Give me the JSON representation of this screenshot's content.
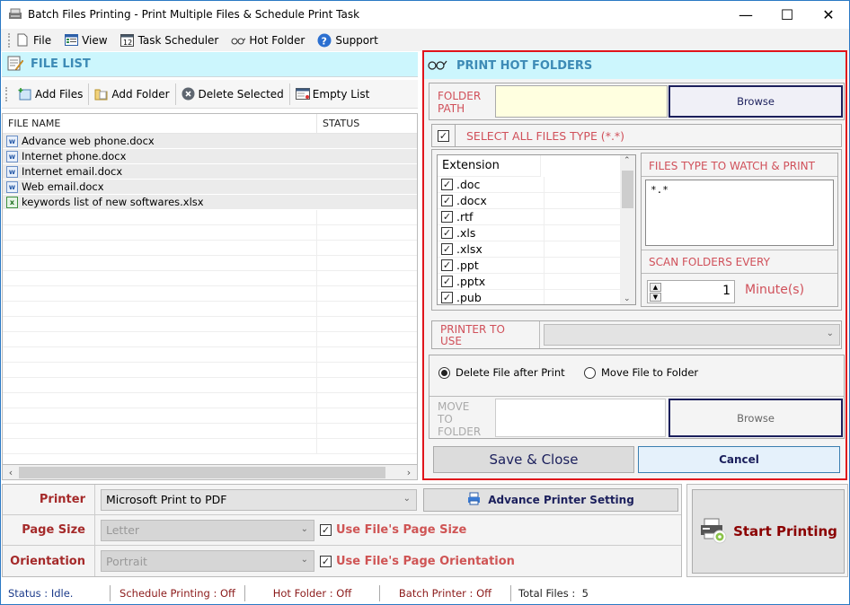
{
  "window": {
    "title": "Batch Files Printing - Print Multiple Files & Schedule Print Task",
    "minimize_glyph": "—",
    "maximize_glyph": "☐",
    "close_glyph": "✕"
  },
  "menu": [
    {
      "label": "File",
      "icon": "file-icon"
    },
    {
      "label": "View",
      "icon": "view-icon"
    },
    {
      "label": "Task Scheduler",
      "icon": "calendar-icon"
    },
    {
      "label": "Hot Folder",
      "icon": "glasses-icon"
    },
    {
      "label": "Support",
      "icon": "help-icon"
    }
  ],
  "file_list": {
    "title": "FILE LIST",
    "toolbar": {
      "add_files": "Add Files",
      "add_folder": "Add Folder",
      "delete_selected": "Delete Selected",
      "empty_list": "Empty List"
    },
    "columns": [
      "FILE NAME",
      "STATUS"
    ],
    "files": [
      {
        "name": "Advance web phone.docx",
        "type": "word",
        "status": ""
      },
      {
        "name": "Internet phone.docx",
        "type": "word",
        "status": ""
      },
      {
        "name": "Internet email.docx",
        "type": "word",
        "status": ""
      },
      {
        "name": "Web email.docx",
        "type": "word",
        "status": ""
      },
      {
        "name": "keywords list of new softwares.xlsx",
        "type": "excel",
        "status": ""
      }
    ]
  },
  "hot_folder": {
    "title": "PRINT HOT FOLDERS",
    "folder_path_label_1": "FOLDER",
    "folder_path_label_2": "PATH",
    "folder_path_value": "",
    "browse": "Browse",
    "select_all_label": "SELECT ALL FILES TYPE (*.*)",
    "select_all_checked": true,
    "extension_header": "Extension",
    "extensions": [
      {
        "ext": ".doc",
        "checked": true
      },
      {
        "ext": ".docx",
        "checked": true
      },
      {
        "ext": ".rtf",
        "checked": true
      },
      {
        "ext": ".xls",
        "checked": true
      },
      {
        "ext": ".xlsx",
        "checked": true
      },
      {
        "ext": ".ppt",
        "checked": true
      },
      {
        "ext": ".pptx",
        "checked": true
      },
      {
        "ext": ".pub",
        "checked": true
      }
    ],
    "watch_label": "FILES TYPE TO WATCH & PRINT",
    "watch_value": "*.*",
    "scan_label": "SCAN FOLDERS EVERY",
    "scan_value": "1",
    "scan_unit": "Minute(s)",
    "printer_label_1": "PRINTER TO",
    "printer_label_2": "USE",
    "printer_value": "",
    "delete_after_print": "Delete File after Print",
    "move_to_folder": "Move File to Folder",
    "selected_option": "delete",
    "move_label_1": "MOVE",
    "move_label_2": "TO",
    "move_label_3": "FOLDER",
    "move_value": "",
    "move_browse": "Browse",
    "save_close": "Save & Close",
    "cancel": "Cancel"
  },
  "settings": {
    "printer_label": "Printer",
    "printer_value": "Microsoft Print to PDF",
    "advance_setting": "Advance Printer Setting",
    "page_size_label": "Page Size",
    "page_size_value": "Letter",
    "use_page_size": "Use File's Page Size",
    "orientation_label": "Orientation",
    "orientation_value": "Portrait",
    "use_orientation": "Use File's Page Orientation",
    "start_printing": "Start Printing"
  },
  "status": {
    "status": "Status :",
    "status_value": "Idle.",
    "schedule": "Schedule Printing : Off",
    "hot_folder": "Hot Folder : Off",
    "batch_printer": "Batch Printer : Off",
    "total_files_label": "Total Files :",
    "total_files_value": "5"
  },
  "colors": {
    "accent_header_bg": "#ccf6fd",
    "header_text": "#3d8bb6",
    "panel_border": "#e0141b",
    "label_red": "#d0505a",
    "dark_red": "#8b0000"
  }
}
